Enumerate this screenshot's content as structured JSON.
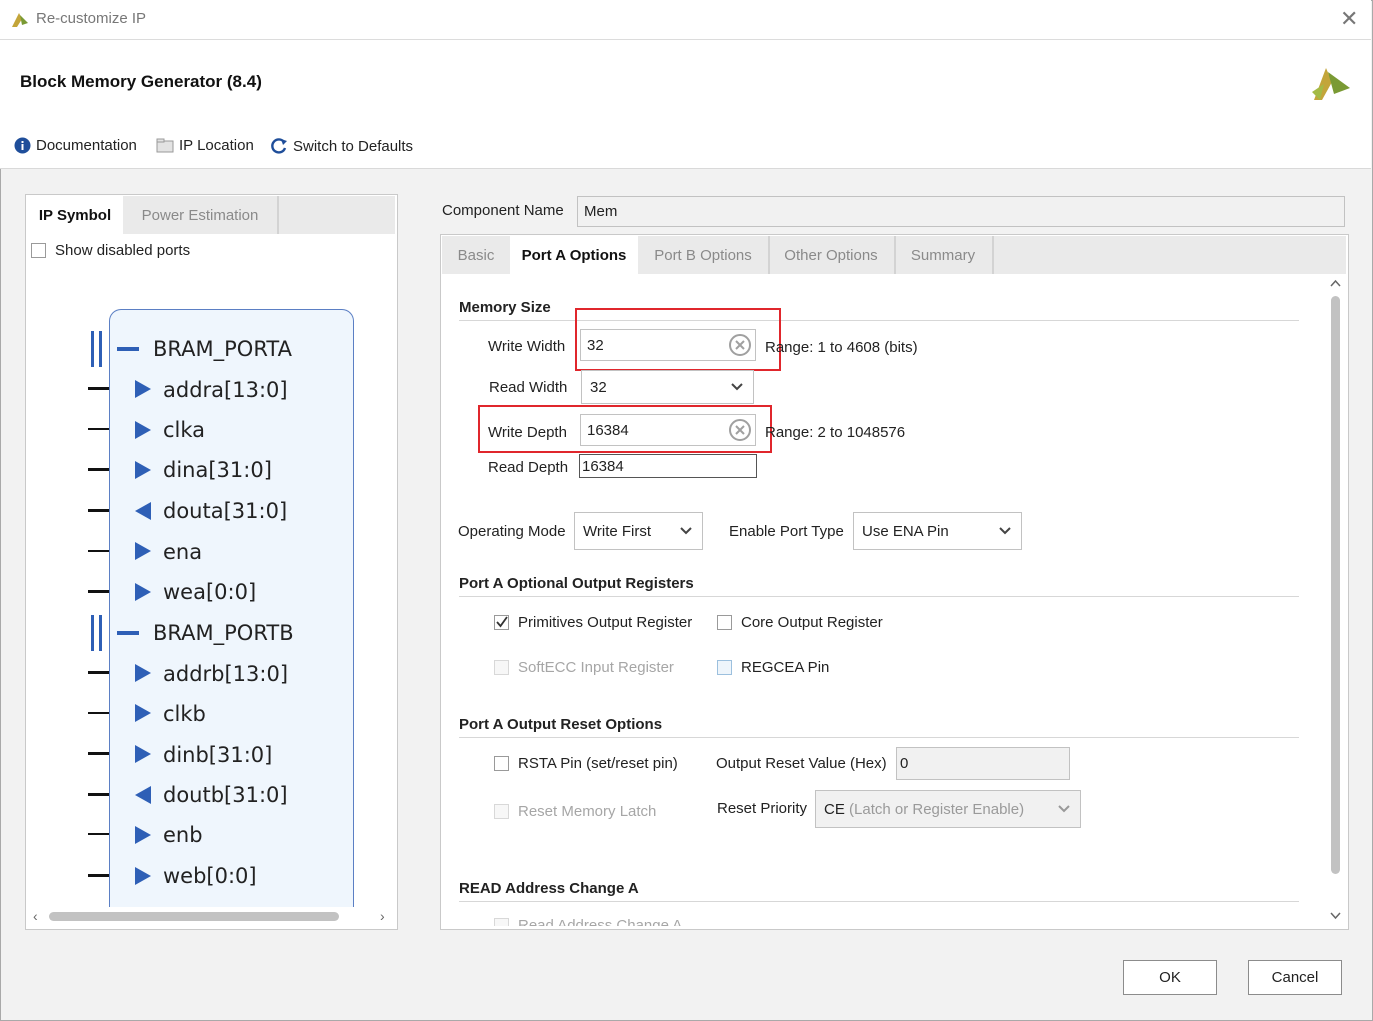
{
  "window": {
    "title": "Re-customize IP",
    "close_glyph": "✕"
  },
  "header": {
    "ip_title": "Block Memory Generator (8.4)"
  },
  "toolbar": {
    "documentation": "Documentation",
    "ip_location": "IP Location",
    "switch_defaults": "Switch to Defaults"
  },
  "left_panel": {
    "tabs": [
      "IP Symbol",
      "Power Estimation"
    ],
    "show_disabled_ports": "Show disabled ports",
    "symbol": {
      "group_a": "BRAM_PORTA",
      "ports_a": [
        {
          "name": "addra[13:0]",
          "dir": "in"
        },
        {
          "name": "clka",
          "dir": "in"
        },
        {
          "name": "dina[31:0]",
          "dir": "in"
        },
        {
          "name": "douta[31:0]",
          "dir": "out"
        },
        {
          "name": "ena",
          "dir": "in"
        },
        {
          "name": "wea[0:0]",
          "dir": "in"
        }
      ],
      "group_b": "BRAM_PORTB",
      "ports_b": [
        {
          "name": "addrb[13:0]",
          "dir": "in"
        },
        {
          "name": "clkb",
          "dir": "in"
        },
        {
          "name": "dinb[31:0]",
          "dir": "in"
        },
        {
          "name": "doutb[31:0]",
          "dir": "out"
        },
        {
          "name": "enb",
          "dir": "in"
        },
        {
          "name": "web[0:0]",
          "dir": "in"
        }
      ]
    }
  },
  "component": {
    "label": "Component Name",
    "value": "Mem"
  },
  "tabs": [
    "Basic",
    "Port A Options",
    "Port B Options",
    "Other Options",
    "Summary"
  ],
  "memory_size": {
    "heading": "Memory Size",
    "write_width_label": "Write Width",
    "write_width_value": "32",
    "write_width_range": "Range: 1 to 4608 (bits)",
    "read_width_label": "Read Width",
    "read_width_value": "32",
    "write_depth_label": "Write Depth",
    "write_depth_value": "16384",
    "write_depth_range": "Range: 2 to 1048576",
    "read_depth_label": "Read Depth",
    "read_depth_value": "16384"
  },
  "operating": {
    "mode_label": "Operating Mode",
    "mode_value": "Write First",
    "enable_label": "Enable Port Type",
    "enable_value": "Use ENA Pin"
  },
  "output_registers": {
    "heading": "Port A Optional Output Registers",
    "primitives": "Primitives Output Register",
    "core": "Core Output Register",
    "softecc": "SoftECC Input Register",
    "regcea": "REGCEA Pin"
  },
  "reset_options": {
    "heading": "Port A Output Reset Options",
    "rsta": "RSTA Pin (set/reset pin)",
    "output_reset_label": "Output Reset Value (Hex)",
    "output_reset_value": "0",
    "reset_latch": "Reset Memory Latch",
    "priority_label": "Reset Priority",
    "priority_value_main": "CE",
    "priority_value_rest": " (Latch or Register Enable)"
  },
  "read_address": {
    "heading": "READ Address Change A",
    "item": "Read Address Change A"
  },
  "footer": {
    "ok": "OK",
    "cancel": "Cancel"
  },
  "colors": {
    "highlight": "#e0262c",
    "port_blue": "#2e5fb6",
    "symbol_border": "#5b7fc4"
  }
}
